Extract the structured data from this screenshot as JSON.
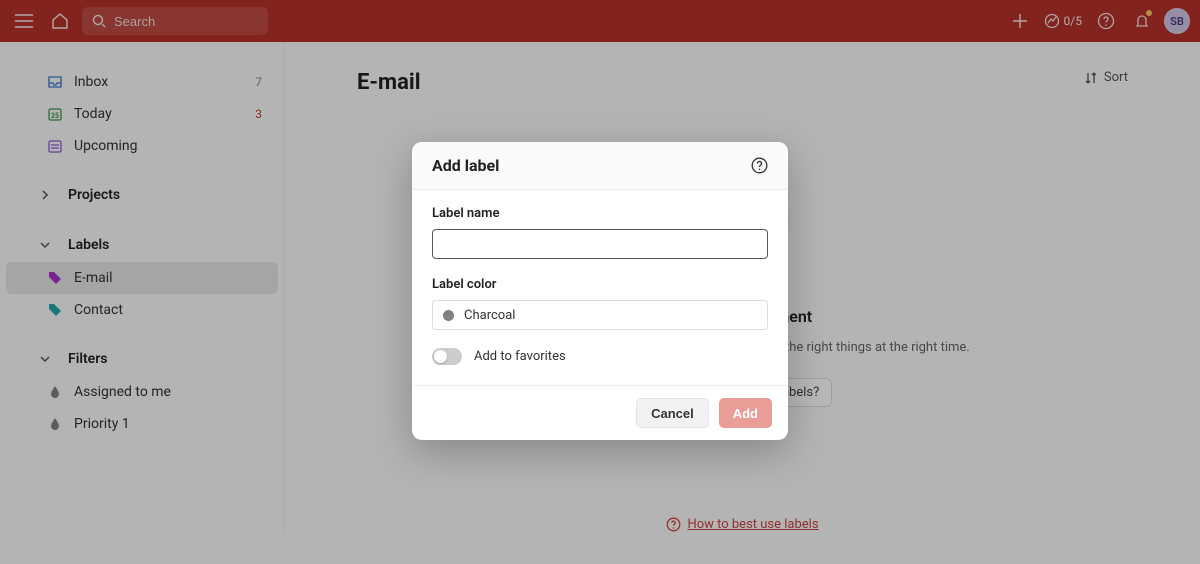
{
  "header": {
    "search_placeholder": "Search",
    "progress": "0/5",
    "avatar_initials": "SB"
  },
  "sidebar": {
    "primary": [
      {
        "label": "Inbox",
        "count": "7",
        "count_color": "gray"
      },
      {
        "label": "Today",
        "count": "3",
        "count_color": "red"
      },
      {
        "label": "Upcoming",
        "count": "",
        "count_color": "gray"
      }
    ],
    "projects_header": "Projects",
    "labels_header": "Labels",
    "labels": [
      {
        "label": "E-mail",
        "active": true
      },
      {
        "label": "Contact",
        "active": false
      }
    ],
    "filters_header": "Filters",
    "filters": [
      {
        "label": "Assigned to me"
      },
      {
        "label": "Priority 1"
      }
    ]
  },
  "main": {
    "title": "E-mail",
    "sort_label": "Sort",
    "hero_title": "Stay in the moment",
    "hero_body": "Tag your tasks by context so you can focus on the right things at the right time.",
    "chip_label": "How can I best use labels?",
    "help_link": "How to best use labels"
  },
  "modal": {
    "title": "Add label",
    "name_label": "Label name",
    "name_value": "",
    "color_label": "Label color",
    "color_value": "Charcoal",
    "favorites_label": "Add to favorites",
    "cancel": "Cancel",
    "add": "Add"
  },
  "colors": {
    "brand": "#b6312a",
    "charcoal_swatch": "#808080"
  }
}
